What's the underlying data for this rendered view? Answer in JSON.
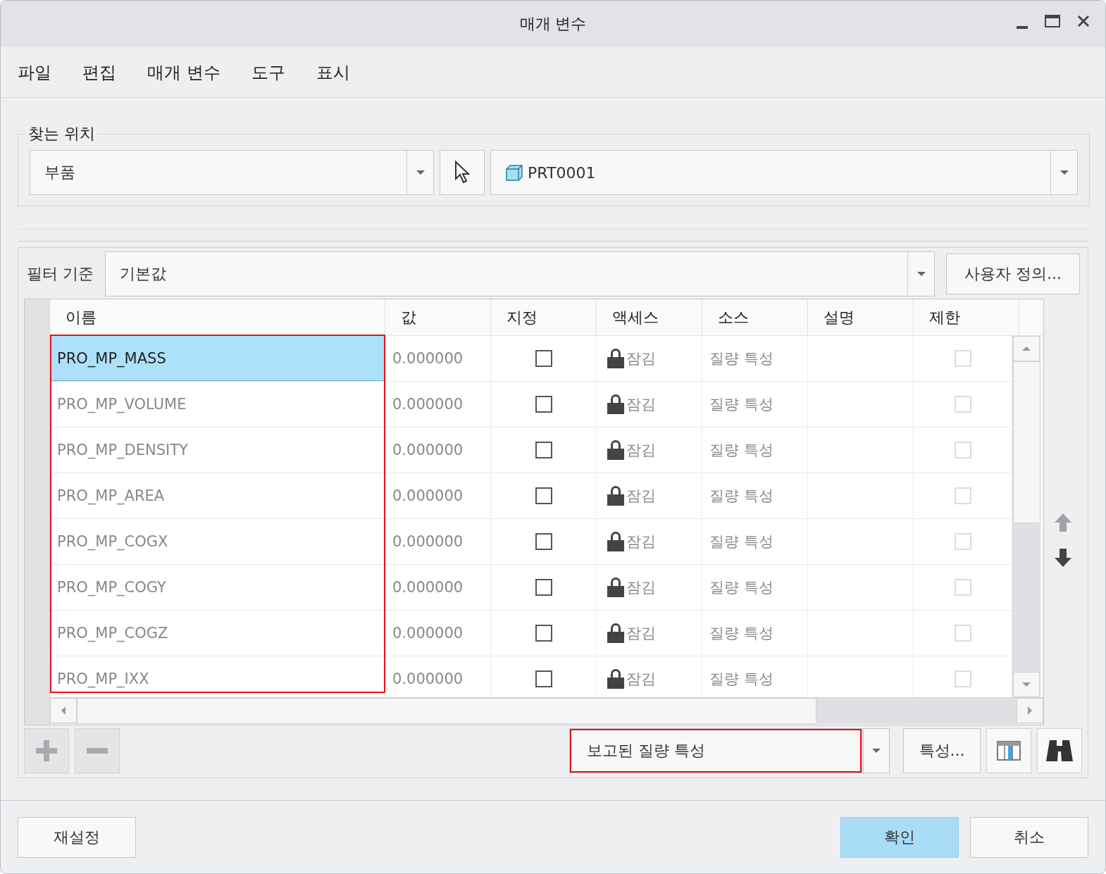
{
  "window": {
    "title": "매개 변수"
  },
  "menu": [
    "파일",
    "편집",
    "매개 변수",
    "도구",
    "표시"
  ],
  "look_in": {
    "label": "찾는 위치",
    "scope": "부품",
    "model": "PRT0001"
  },
  "filter": {
    "label": "필터 기준",
    "value": "기본값",
    "customize": "사용자 정의..."
  },
  "table": {
    "columns": [
      "이름",
      "값",
      "지정",
      "액세스",
      "소스",
      "설명",
      "제한"
    ],
    "name_column_highlighted": true,
    "rows": [
      {
        "name": "PRO_MP_MASS",
        "value": "0.000000",
        "designated": false,
        "access": "잠김",
        "source": "질량 특성",
        "restricted": false,
        "selected": true
      },
      {
        "name": "PRO_MP_VOLUME",
        "value": "0.000000",
        "designated": false,
        "access": "잠김",
        "source": "질량 특성",
        "restricted": false,
        "selected": false
      },
      {
        "name": "PRO_MP_DENSITY",
        "value": "0.000000",
        "designated": false,
        "access": "잠김",
        "source": "질량 특성",
        "restricted": false,
        "selected": false
      },
      {
        "name": "PRO_MP_AREA",
        "value": "0.000000",
        "designated": false,
        "access": "잠김",
        "source": "질량 특성",
        "restricted": false,
        "selected": false
      },
      {
        "name": "PRO_MP_COGX",
        "value": "0.000000",
        "designated": false,
        "access": "잠김",
        "source": "질량 특성",
        "restricted": false,
        "selected": false
      },
      {
        "name": "PRO_MP_COGY",
        "value": "0.000000",
        "designated": false,
        "access": "잠김",
        "source": "질량 특성",
        "restricted": false,
        "selected": false
      },
      {
        "name": "PRO_MP_COGZ",
        "value": "0.000000",
        "designated": false,
        "access": "잠김",
        "source": "질량 특성",
        "restricted": false,
        "selected": false
      },
      {
        "name": "PRO_MP_IXX",
        "value": "0.000000",
        "designated": false,
        "access": "잠김",
        "source": "질량 특성",
        "restricted": false,
        "selected": false
      }
    ]
  },
  "move_buttons": [
    {
      "kind": "up",
      "disabled": true
    },
    {
      "kind": "down",
      "disabled": false
    }
  ],
  "edit_buttons": [
    {
      "kind": "add",
      "disabled": true
    },
    {
      "kind": "remove",
      "disabled": true
    }
  ],
  "property_type": {
    "value": "보고된 질량 특성",
    "highlighted": true
  },
  "properties_button": "특성...",
  "footer": {
    "reset": "재설정",
    "ok": "확인",
    "cancel": "취소"
  }
}
